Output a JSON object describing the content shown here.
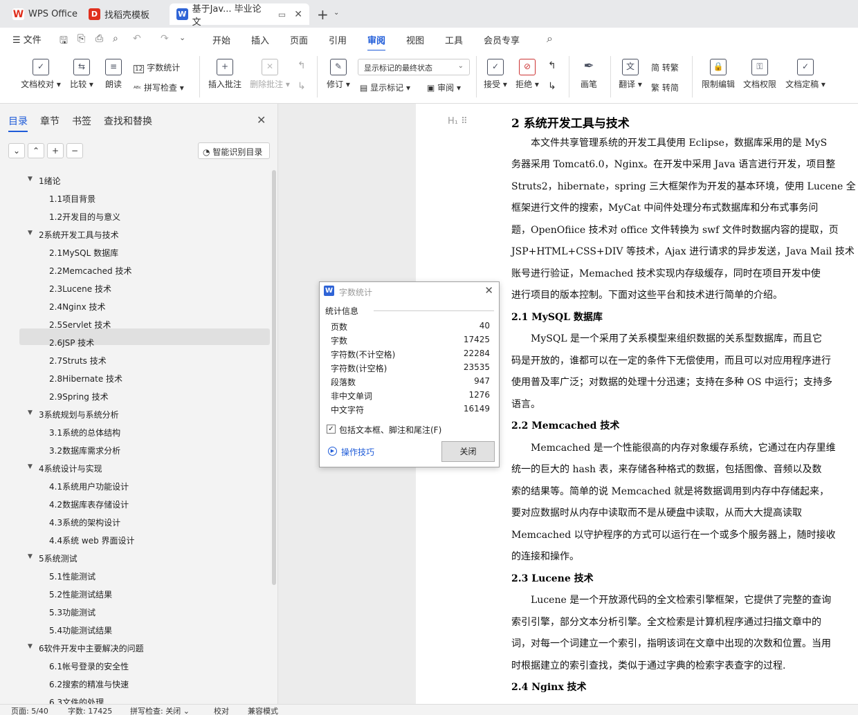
{
  "tabs": [
    {
      "label": "WPS Office",
      "icon": "wps-logo-icon"
    },
    {
      "label": "找稻壳模板",
      "icon": "docer-icon"
    },
    {
      "label": "基于Jav... 毕业论文",
      "icon": "word-doc-icon"
    }
  ],
  "menu": {
    "file": "文件",
    "tabs": [
      "开始",
      "插入",
      "页面",
      "引用",
      "审阅",
      "视图",
      "工具",
      "会员专享"
    ],
    "active": "审阅"
  },
  "ribbon": {
    "doc_proof": "文档校对",
    "compare": "比较",
    "read_aloud": "朗读",
    "word_count": "字数统计",
    "spell_check": "拼写检查",
    "insert_comment": "插入批注",
    "delete_comment": "删除批注",
    "track_changes": "修订",
    "markup_state": "显示标记的最终状态",
    "show_markup": "显示标记",
    "review_pane": "审阅",
    "accept": "接受",
    "reject": "拒绝",
    "ink": "画笔",
    "translate": "翻译",
    "to_traditional": "转繁",
    "to_simplified": "转简",
    "restrict_edit": "限制编辑",
    "doc_permission": "文档权限",
    "doc_finalize": "文档定稿"
  },
  "nav": {
    "tabs": [
      "目录",
      "章节",
      "书签",
      "查找和替换"
    ],
    "smart_toc": "智能识别目录",
    "items": [
      {
        "label": "1绪论",
        "level": 1
      },
      {
        "label": "1.1项目背景",
        "level": 2
      },
      {
        "label": "1.2开发目的与意义",
        "level": 2
      },
      {
        "label": "2系统开发工具与技术",
        "level": 1,
        "selected": true
      },
      {
        "label": "2.1MySQL 数据库",
        "level": 2
      },
      {
        "label": "2.2Memcached 技术",
        "level": 2
      },
      {
        "label": "2.3Lucene 技术",
        "level": 2
      },
      {
        "label": "2.4Nginx 技术",
        "level": 2
      },
      {
        "label": "2.5Servlet 技术",
        "level": 2
      },
      {
        "label": "2.6JSP 技术",
        "level": 2
      },
      {
        "label": "2.7Struts 技术",
        "level": 2
      },
      {
        "label": "2.8Hibernate 技术",
        "level": 2
      },
      {
        "label": "2.9Spring 技术",
        "level": 2
      },
      {
        "label": "3系统规划与系统分析",
        "level": 1
      },
      {
        "label": "3.1系统的总体结构",
        "level": 2
      },
      {
        "label": "3.2数据库需求分析",
        "level": 2
      },
      {
        "label": "4系统设计与实现",
        "level": 1
      },
      {
        "label": "4.1系统用户功能设计",
        "level": 2
      },
      {
        "label": "4.2数据库表存储设计",
        "level": 2
      },
      {
        "label": "4.3系统的架构设计",
        "level": 2
      },
      {
        "label": "4.4系统 web 界面设计",
        "level": 2
      },
      {
        "label": "5系统测试",
        "level": 1
      },
      {
        "label": "5.1性能测试",
        "level": 2
      },
      {
        "label": "5.2性能测试结果",
        "level": 2
      },
      {
        "label": "5.3功能测试",
        "level": 2
      },
      {
        "label": "5.4功能测试结果",
        "level": 2
      },
      {
        "label": "6软件开发中主要解决的问题",
        "level": 1
      },
      {
        "label": "6.1帐号登录的安全性",
        "level": 2
      },
      {
        "label": "6.2搜索的精准与快速",
        "level": 2
      },
      {
        "label": "6.3文件的处理",
        "level": 2
      }
    ]
  },
  "doc": {
    "lines": [
      {
        "type": "h1",
        "text": "2 系统开发工具与技术"
      },
      {
        "type": "p",
        "text": "　　本文件共享管理系统的开发工具使用 Eclipse，数据库采用的是 MyS"
      },
      {
        "type": "p",
        "text": "务器采用 Tomcat6.0，Nginx。在开发中采用 Java 语言进行开发，项目整"
      },
      {
        "type": "p",
        "text": "Struts2，hibernate，spring 三大框架作为开发的基本环境，使用 Lucene 全"
      },
      {
        "type": "p",
        "text": "框架进行文件的搜索，MyCat 中间件处理分布式数据库和分布式事务问"
      },
      {
        "type": "p",
        "text": "题，OpenOfiice 技术对 office 文件转换为 swf 文件时数据内容的提取，页"
      },
      {
        "type": "p",
        "text": "JSP+HTML+CSS+DIV 等技术，Ajax 进行请求的异步发送，Java Mail 技术"
      },
      {
        "type": "p",
        "text": "账号进行验证，Memached 技术实现内存级缓存，同时在项目开发中使"
      },
      {
        "type": "p",
        "text": "进行项目的版本控制。下面对这些平台和技术进行简单的介绍。"
      },
      {
        "type": "h2",
        "text": "2.1 MySQL 数据库"
      },
      {
        "type": "p",
        "text": "　　MySQL 是一个采用了关系模型来组织数据的关系型数据库，而且它"
      },
      {
        "type": "p",
        "text": "码是开放的，谁都可以在一定的条件下无偿使用，而且可以对应用程序进行"
      },
      {
        "type": "p",
        "text": "使用普及率广泛；对数据的处理十分迅速；支持在多种 OS 中运行；支持多"
      },
      {
        "type": "p",
        "text": "语言。"
      },
      {
        "type": "h2",
        "text": "2.2 Memcached 技术"
      },
      {
        "type": "p",
        "text": "　　Memcached 是一个性能很高的内存对象缓存系统，它通过在内存里维"
      },
      {
        "type": "p",
        "text": "统一的巨大的 hash 表，来存储各种格式的数据，包括图像、音频以及数"
      },
      {
        "type": "p",
        "text": "索的结果等。简单的说 Memcached 就是将数据调用到内存中存储起来，"
      },
      {
        "type": "p",
        "text": "要对应数据时从内存中读取而不是从硬盘中读取，从而大大提高读取"
      },
      {
        "type": "p",
        "text": "Memcached 以守护程序的方式可以运行在一个或多个服务器上，随时接收"
      },
      {
        "type": "p",
        "text": "的连接和操作。"
      },
      {
        "type": "h2",
        "text": "2.3 Lucene 技术"
      },
      {
        "type": "p",
        "text": "　　Lucene 是一个开放源代码的全文检索引擎框架，它提供了完整的查询"
      },
      {
        "type": "p",
        "text": "索引引擎，部分文本分析引擎。全文检索是计算机程序通过扫描文章中的"
      },
      {
        "type": "p",
        "text": "词，对每一个词建立一个索引，指明该词在文章中出现的次数和位置。当用"
      },
      {
        "type": "p",
        "text": "时根据建立的索引查找，类似于通过字典的检索字表查字的过程."
      },
      {
        "type": "h2",
        "text": "2.4 Nginx 技术"
      }
    ]
  },
  "dialog": {
    "title": "字数统计",
    "section": "统计信息",
    "stats": [
      {
        "label": "页数",
        "value": "40"
      },
      {
        "label": "字数",
        "value": "17425"
      },
      {
        "label": "字符数(不计空格)",
        "value": "22284"
      },
      {
        "label": "字符数(计空格)",
        "value": "23535"
      },
      {
        "label": "段落数",
        "value": "947"
      },
      {
        "label": "非中文单词",
        "value": "1276"
      },
      {
        "label": "中文字符",
        "value": "16149"
      }
    ],
    "checkbox_label": "包括文本框、脚注和尾注(F)",
    "checked": true,
    "tips": "操作技巧",
    "close": "关闭"
  },
  "status": {
    "page": "页面: 5/40",
    "words": "字数: 17425",
    "spell": "拼写检查: 关闭",
    "proof": "校对",
    "compat": "兼容模式"
  }
}
